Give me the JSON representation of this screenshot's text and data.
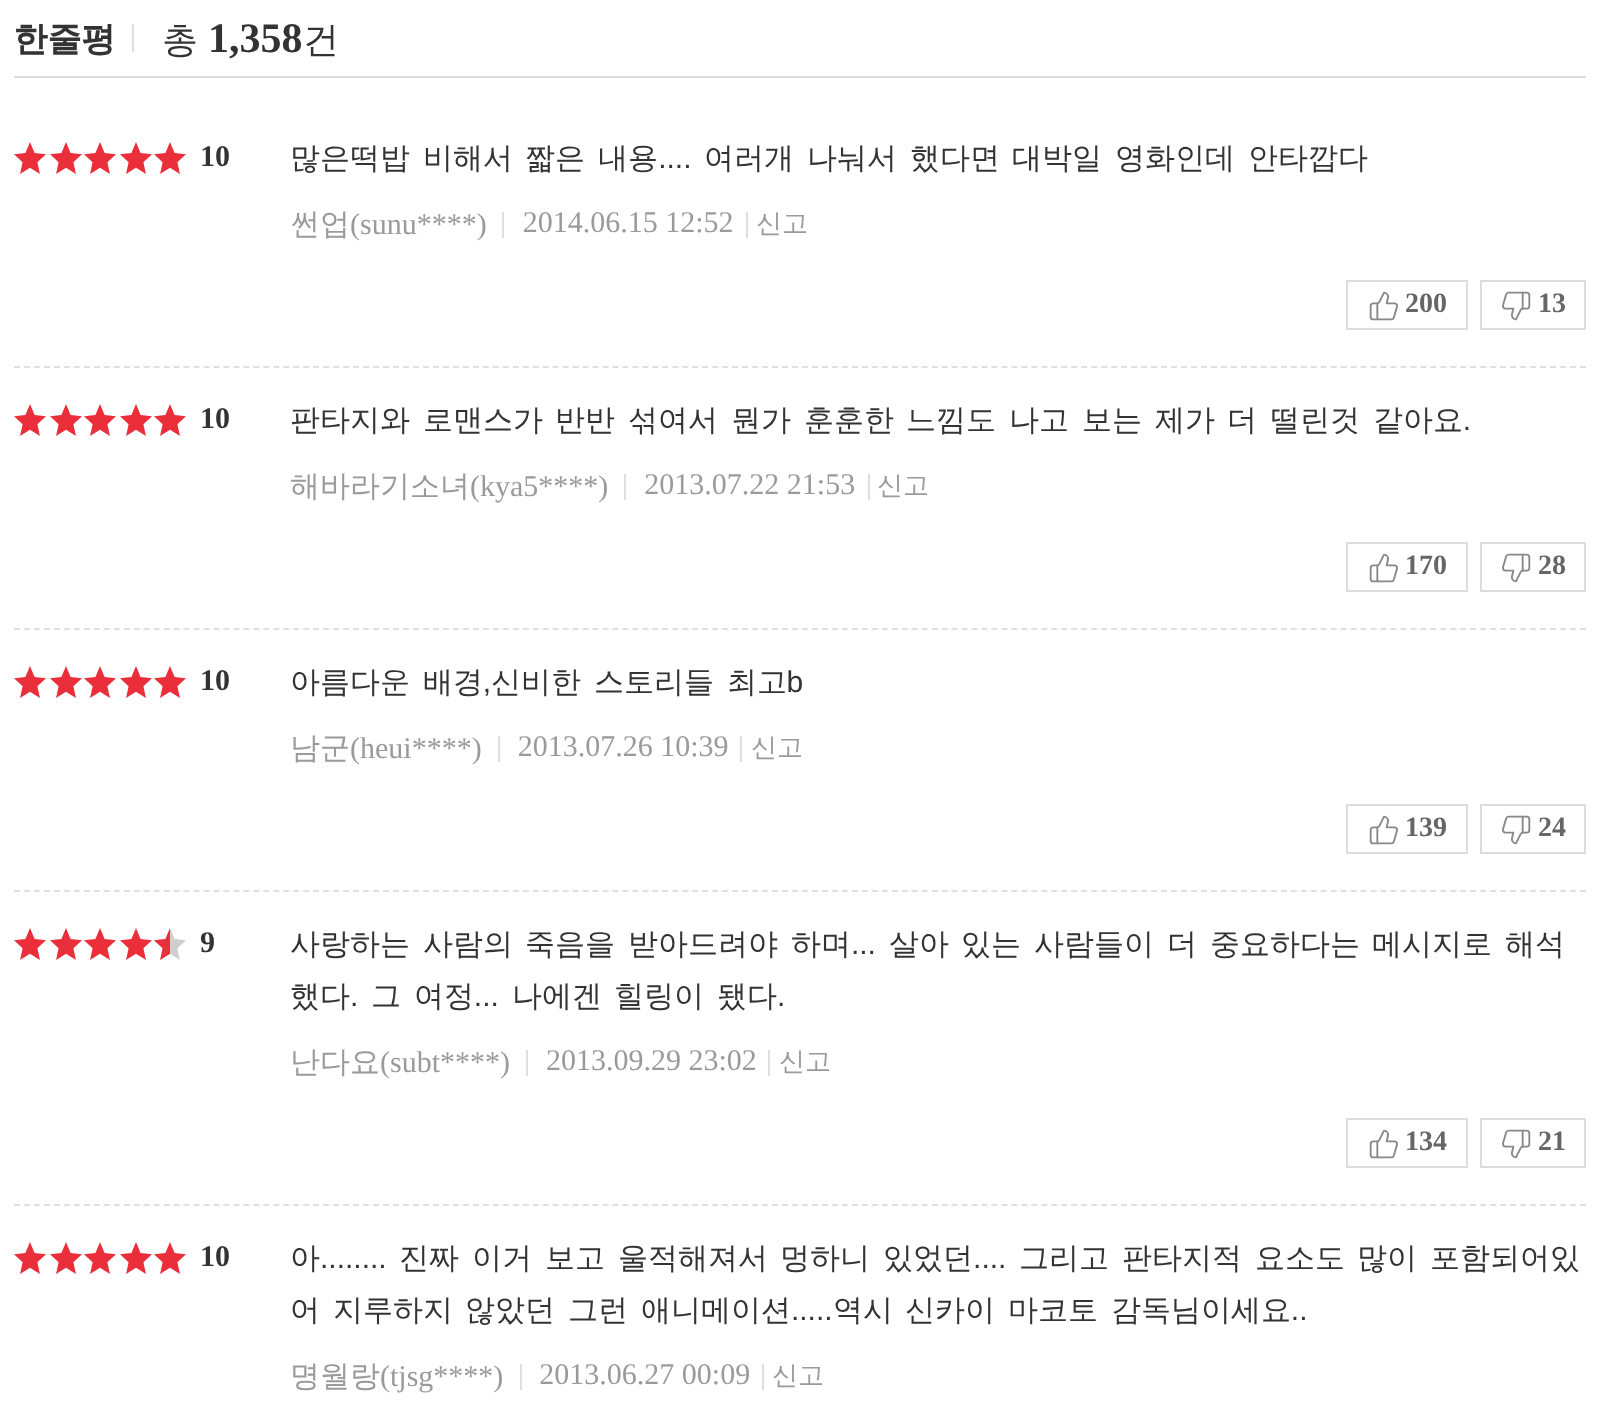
{
  "header": {
    "title": "한줄평",
    "total": "총 **1,358**건"
  },
  "reviews": [
    {
      "stars": 5,
      "score": "10",
      "text": "많은떡밥 비해서 짧은 내용.... 여러개 나눠서 했다면 대박일 영화인데 안타깝다",
      "author": "썬업(sunu****)",
      "date": "2014.06.15 12:52",
      "report": "신고",
      "likes": "200",
      "dislikes": "13"
    },
    {
      "stars": 5,
      "score": "10",
      "text": "판타지와 로맨스가 반반 섞여서 뭔가 훈훈한 느낌도 나고 보는 제가 더 떨린것 같아요.",
      "author": "해바라기소녀(kya5****)",
      "date": "2013.07.22 21:53",
      "report": "신고",
      "likes": "170",
      "dislikes": "28"
    },
    {
      "stars": 5,
      "score": "10",
      "text": "아름다운 배경,신비한 스토리들 최고b",
      "author": "남군(heui****)",
      "date": "2013.07.26 10:39",
      "report": "신고",
      "likes": "139",
      "dislikes": "24"
    },
    {
      "stars": 4.5,
      "score": "9",
      "text": "사랑하는 사람의 죽음을 받아드려야 하며... 살아 있는 사람들이 더 중요하다는 메시지로 해석했다. 그 여정... 나에겐 힐링이 됐다.",
      "author": "난다요(subt****)",
      "date": "2013.09.29 23:02",
      "report": "신고",
      "likes": "134",
      "dislikes": "21"
    },
    {
      "stars": 5,
      "score": "10",
      "text": "아........ 진짜 이거 보고 울적해져서 멍하니 있었던.... 그리고 판타지적 요소도 많이 포함되어있어 지루하지 않았던 그런 애니메이션.....역시 신카이 마코토 감독님이세요..",
      "author": "명월랑(tjsg****)",
      "date": "2013.06.27 00:09",
      "report": "신고"
    }
  ]
}
